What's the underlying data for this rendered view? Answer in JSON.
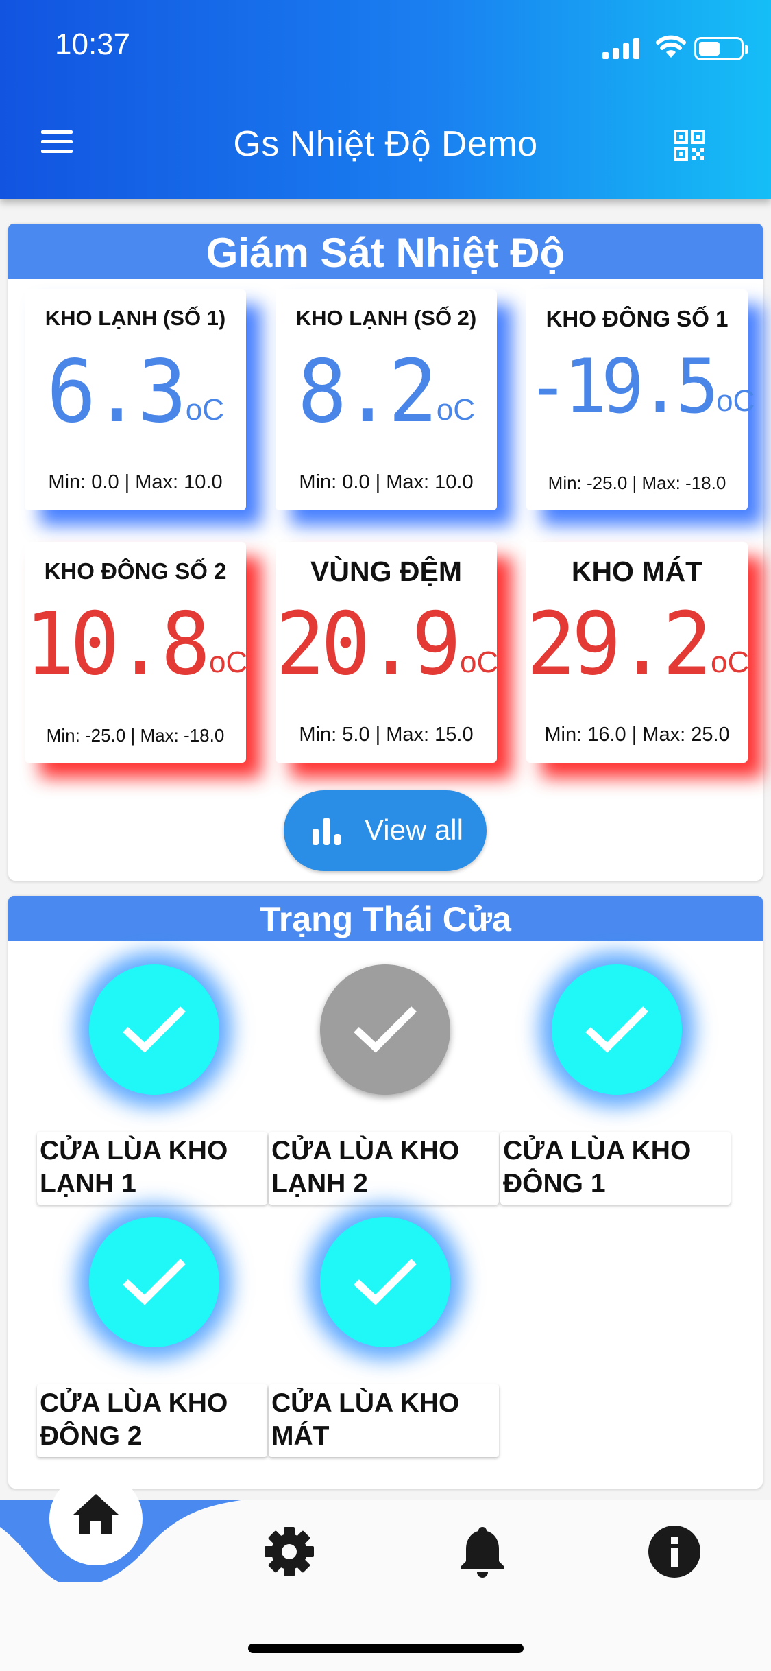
{
  "status_bar": {
    "time": "10:37"
  },
  "header": {
    "title": "Gs Nhiệt Độ Demo"
  },
  "temperature_panel": {
    "title": "Giám Sát Nhiệt Độ",
    "sensors": [
      {
        "name": "KHO LẠNH (SỐ 1)",
        "value": "6.3",
        "unit": "oC",
        "range": "Min: 0.0 | Max: 10.0",
        "status": "normal"
      },
      {
        "name": "KHO LẠNH (SỐ 2)",
        "value": "8.2",
        "unit": "oC",
        "range": "Min: 0.0 | Max: 10.0",
        "status": "normal"
      },
      {
        "name": "KHO ĐÔNG SỐ 1",
        "value": "-19.5",
        "unit": "oC",
        "range": "Min: -25.0 | Max: -18.0",
        "status": "normal"
      },
      {
        "name": "KHO ĐÔNG SỐ 2",
        "value": "10.8",
        "unit": "oC",
        "range": "Min: -25.0 | Max: -18.0",
        "status": "alarm"
      },
      {
        "name": "VÙNG ĐỆM",
        "value": "20.9",
        "unit": "oC",
        "range": "Min: 5.0 | Max: 15.0",
        "status": "alarm"
      },
      {
        "name": "KHO MÁT",
        "value": "29.2",
        "unit": "oC",
        "range": "Min: 16.0 | Max: 25.0",
        "status": "alarm"
      }
    ],
    "view_all_label": "View all"
  },
  "door_panel": {
    "title": "Trạng Thái Cửa",
    "doors": [
      {
        "name": "CỬA LÙA KHO LẠNH 1",
        "state": "active"
      },
      {
        "name": "CỬA LÙA KHO LẠNH 2",
        "state": "inactive"
      },
      {
        "name": "CỬA LÙA KHO ĐÔNG 1",
        "state": "active"
      },
      {
        "name": "CỬA LÙA KHO ĐÔNG 2",
        "state": "active"
      },
      {
        "name": "CỬA LÙA KHO MÁT",
        "state": "active"
      }
    ]
  },
  "bottom_nav": {
    "items": [
      {
        "icon": "home-icon",
        "selected": true
      },
      {
        "icon": "gear-icon",
        "selected": false
      },
      {
        "icon": "bell-icon",
        "selected": false
      },
      {
        "icon": "info-icon",
        "selected": false
      }
    ]
  },
  "colors": {
    "header_gradient_start": "#1254e0",
    "header_gradient_end": "#15bef6",
    "panel_title_bg": "#4a8af0",
    "normal_value": "#4a86e8",
    "alarm_value": "#e33a35",
    "door_active": "#1ff8f6",
    "door_inactive": "#9e9e9e",
    "button_bg": "#2a8ee6"
  }
}
